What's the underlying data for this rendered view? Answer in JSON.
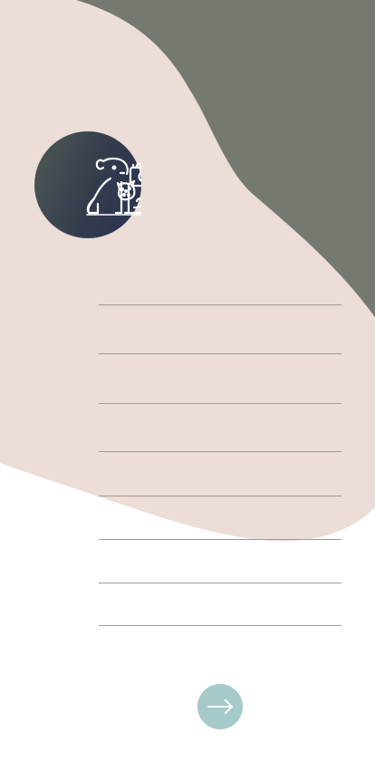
{
  "theme": {
    "page_background": "#ffffff",
    "blob_beige": "#ecddd6",
    "blob_green": "#747a70",
    "logo_gradient": [
      "#4e5a55",
      "#2a3153"
    ],
    "button_color": "#a6c9c9",
    "input_line_color": "#a09a96"
  },
  "header": {
    "logo_icon": "dog-cat-camera-icon"
  },
  "form": {
    "fields": [
      {
        "value": "",
        "placeholder": ""
      },
      {
        "value": "",
        "placeholder": ""
      },
      {
        "value": "",
        "placeholder": ""
      },
      {
        "value": "",
        "placeholder": ""
      },
      {
        "value": "",
        "placeholder": ""
      },
      {
        "value": "",
        "placeholder": ""
      },
      {
        "value": "",
        "placeholder": ""
      },
      {
        "value": "",
        "placeholder": ""
      }
    ],
    "next_button_icon": "arrow-right-icon"
  }
}
